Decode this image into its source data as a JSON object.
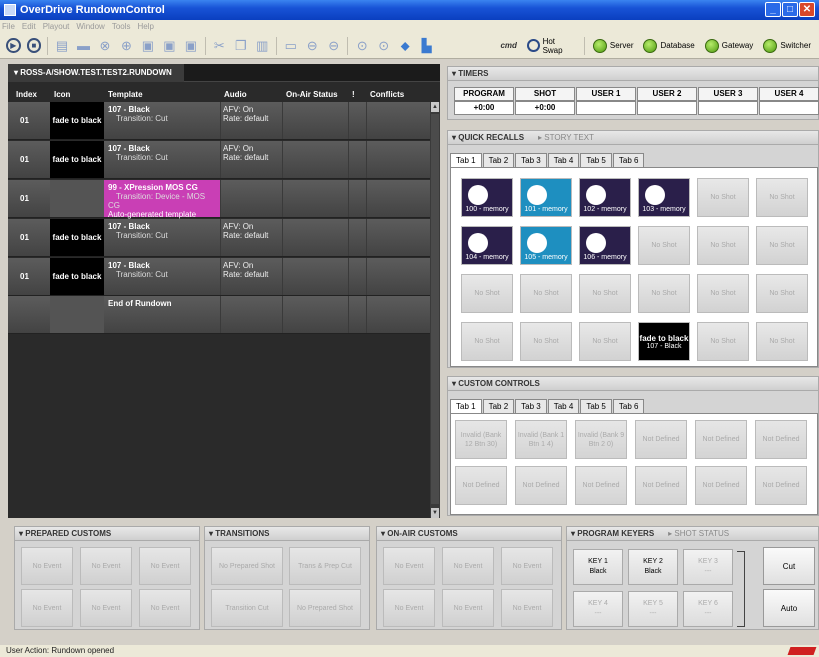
{
  "window": {
    "title": "OverDrive RundownControl"
  },
  "menu": [
    "File",
    "Edit",
    "Playout",
    "Window",
    "Tools",
    "Help"
  ],
  "toolbar": {
    "hot_swap": "Hot Swap",
    "server": "Server",
    "database": "Database",
    "gateway": "Gateway",
    "switcher": "Switcher",
    "logo": "cmd"
  },
  "rundown": {
    "title": "ROSS-A/SHOW.TEST.TEST2.RUNDOWN",
    "columns": [
      "Index",
      "Icon",
      "Template",
      "Audio",
      "On-Air Status",
      "!",
      "Conflicts"
    ],
    "rows": [
      {
        "index": "01",
        "icon": "fade to black",
        "template": "107 - Black",
        "line2": "Transition: Cut",
        "line3": "",
        "audio1": "AFV: On",
        "audio2": "Rate: default"
      },
      {
        "index": "01",
        "icon": "fade to black",
        "template": "107 - Black",
        "line2": "Transition: Cut",
        "line3": "",
        "audio1": "AFV: On",
        "audio2": "Rate: default"
      },
      {
        "index": "01",
        "icon": "",
        "template": "99 - XPression MOS CG",
        "line2": "Transition: Device - MOS CG",
        "line3": "Auto-generated template",
        "audio1": "",
        "audio2": ""
      },
      {
        "index": "01",
        "icon": "fade to black",
        "template": "107 - Black",
        "line2": "Transition: Cut",
        "line3": "",
        "audio1": "AFV: On",
        "audio2": "Rate: default"
      },
      {
        "index": "01",
        "icon": "fade to black",
        "template": "107 - Black",
        "line2": "Transition: Cut",
        "line3": "",
        "audio1": "AFV: On",
        "audio2": "Rate: default"
      }
    ],
    "end_label": "End of Rundown"
  },
  "timers": {
    "title": "TIMERS",
    "headers": [
      "PROGRAM",
      "SHOT",
      "USER 1",
      "USER 2",
      "USER 3",
      "USER 4"
    ],
    "values": [
      "+0:00",
      "+0:00",
      "",
      "",
      "",
      ""
    ]
  },
  "quick_recalls": {
    "title": "QUICK RECALLS",
    "subtitle": "STORY TEXT",
    "tabs": [
      "Tab 1",
      "Tab 2",
      "Tab 3",
      "Tab 4",
      "Tab 5",
      "Tab 6"
    ],
    "shots": [
      "100 - memory",
      "101 - memory",
      "102 - memory",
      "103 - memory",
      "No Shot",
      "No Shot",
      "104 - memory",
      "105 - memory",
      "106 - memory",
      "No Shot",
      "No Shot",
      "No Shot",
      "No Shot",
      "No Shot",
      "No Shot",
      "No Shot",
      "No Shot",
      "No Shot",
      "No Shot",
      "No Shot",
      "No Shot",
      "fade to black|107 - Black",
      "No Shot",
      "No Shot"
    ]
  },
  "custom_controls": {
    "title": "CUSTOM CONTROLS",
    "tabs": [
      "Tab 1",
      "Tab 2",
      "Tab 3",
      "Tab 4",
      "Tab 5",
      "Tab 6"
    ],
    "controls": [
      "Invalid (Bank 12 Btn 30)",
      "Invalid (Bank 1 Btn 1 4)",
      "Invalid (Bank 9 Btn 2 0)",
      "Not Defined",
      "Not Defined",
      "Not Defined",
      "Not Defined",
      "Not Defined",
      "Not Defined",
      "Not Defined",
      "Not Defined",
      "Not Defined"
    ]
  },
  "prepared_customs": {
    "title": "PREPARED CUSTOMS",
    "events": [
      "No Event",
      "No Event",
      "No Event",
      "No Event",
      "No Event",
      "No Event"
    ]
  },
  "transitions": {
    "title": "TRANSITIONS",
    "items": [
      "No Prepared Shot",
      "Trans & Prep Cut",
      "Transition Cut",
      "No Prepared Shot"
    ]
  },
  "on_air_customs": {
    "title": "ON-AIR CUSTOMS",
    "events": [
      "No Event",
      "No Event",
      "No Event",
      "No Event",
      "No Event",
      "No Event"
    ]
  },
  "program_keyers": {
    "title": "PROGRAM KEYERS",
    "subtitle": "SHOT STATUS",
    "keys": [
      {
        "name": "KEY 1",
        "value": "Black"
      },
      {
        "name": "KEY 2",
        "value": "Black"
      },
      {
        "name": "KEY 3",
        "value": "---"
      },
      {
        "name": "KEY 4",
        "value": "---"
      },
      {
        "name": "KEY 5",
        "value": "---"
      },
      {
        "name": "KEY 6",
        "value": "---"
      }
    ],
    "cut": "Cut",
    "auto": "Auto"
  },
  "status": {
    "text": "User Action: Rundown opened"
  }
}
